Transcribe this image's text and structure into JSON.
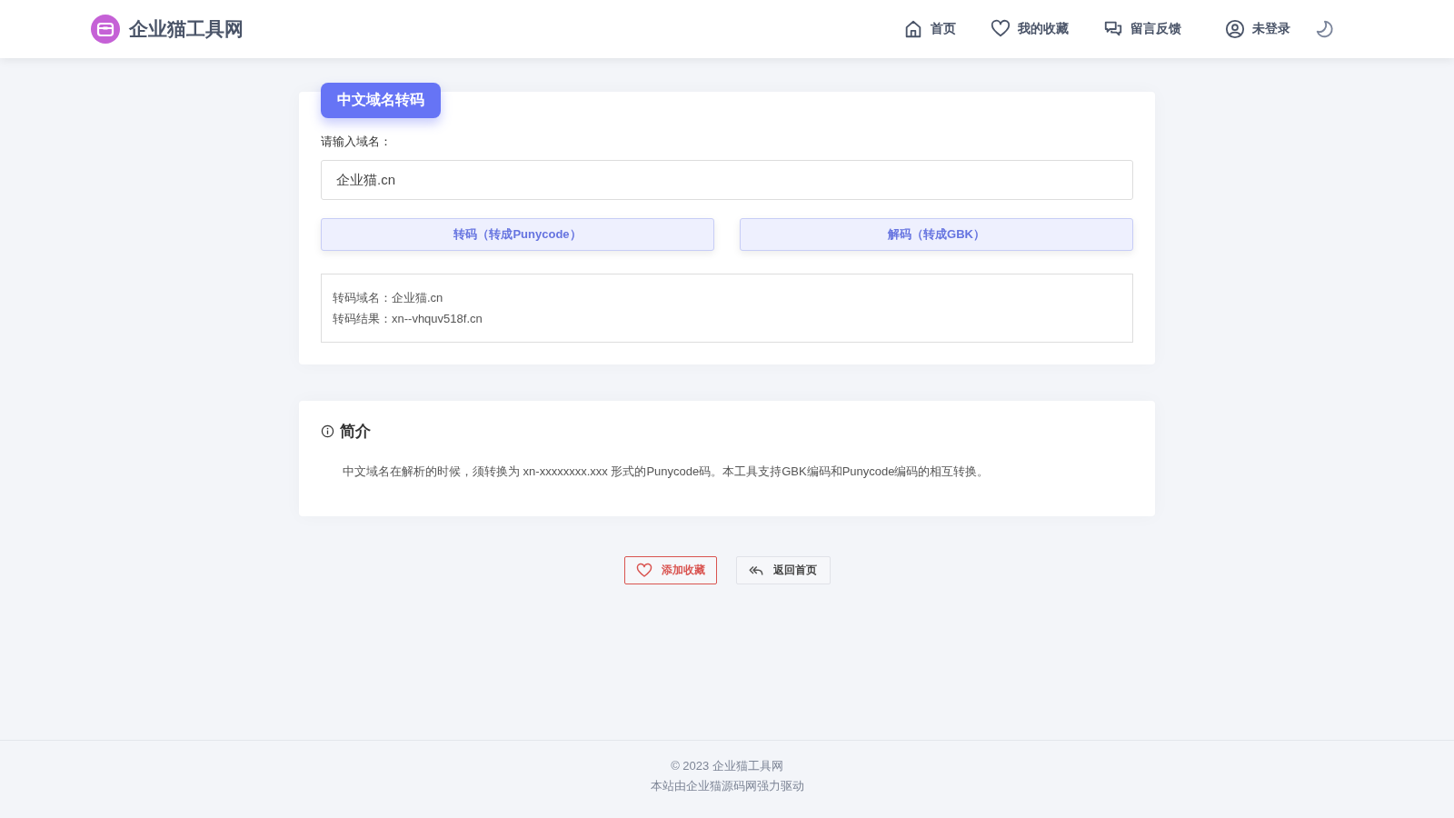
{
  "header": {
    "logo": "企业猫工具网",
    "nav": [
      {
        "kind": "home",
        "label": "首页"
      },
      {
        "kind": "heart",
        "label": "我的收藏"
      },
      {
        "kind": "chat",
        "label": "留言反馈"
      },
      {
        "kind": "user",
        "label": "未登录"
      }
    ]
  },
  "tool": {
    "badge": "中文域名转码",
    "field_label": "请输入域名：",
    "input_value": "企业猫.cn",
    "buttons": [
      "转码（转成Punycode）",
      "解码（转成GBK）"
    ],
    "result_lines": [
      "转码域名：企业猫.cn",
      "转码结果：xn--vhquv518f.cn"
    ]
  },
  "intro": {
    "title": "简介",
    "text": "中文域名在解析的时候，须转换为 xn-xxxxxxxx.xxx 形式的Punycode码。本工具支持GBK编码和Punycode编码的相互转换。"
  },
  "actions": [
    {
      "kind": "favorite",
      "label": "添加收藏"
    },
    {
      "kind": "back",
      "label": "返回首页"
    }
  ],
  "footer": {
    "lines": [
      "© 2023 企业猫工具网",
      "本站由企业猫源码网强力驱动"
    ]
  }
}
